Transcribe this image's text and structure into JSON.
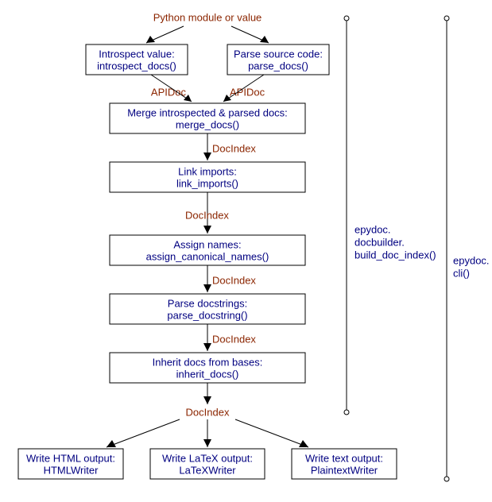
{
  "top_label": "Python module or value",
  "nodes": {
    "introspect": {
      "l1": "Introspect value:",
      "l2": "introspect_docs()"
    },
    "parse": {
      "l1": "Parse source code:",
      "l2": "parse_docs()"
    },
    "merge": {
      "l1": "Merge introspected & parsed docs:",
      "l2": "merge_docs()"
    },
    "link": {
      "l1": "Link imports:",
      "l2": "link_imports()"
    },
    "assign": {
      "l1": "Assign names:",
      "l2": "assign_canonical_names()"
    },
    "parsedoc": {
      "l1": "Parse docstrings:",
      "l2": "parse_docstring()"
    },
    "inherit": {
      "l1": "Inherit docs from bases:",
      "l2": "inherit_docs()"
    },
    "html": {
      "l1": "Write HTML output:",
      "l2": "HTMLWriter"
    },
    "latex": {
      "l1": "Write LaTeX output:",
      "l2": "LaTeXWriter"
    },
    "text": {
      "l1": "Write text output:",
      "l2": "PlaintextWriter"
    }
  },
  "edges": {
    "apidoc_l": "APIDoc",
    "apidoc_r": "APIDoc",
    "docindex1": "DocIndex",
    "docindex2": "DocIndex",
    "docindex3": "DocIndex",
    "docindex4": "DocIndex",
    "docindex5": "DocIndex"
  },
  "brackets": {
    "inner_l1": "epydoc.",
    "inner_l2": "docbuilder.",
    "inner_l3": "build_doc_index()",
    "outer_l1": "epydoc.",
    "outer_l2": "cli()"
  }
}
